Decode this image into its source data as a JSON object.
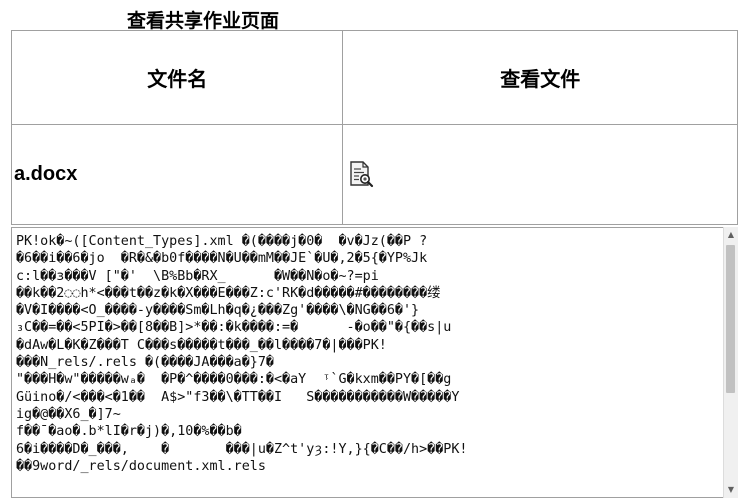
{
  "page": {
    "title": "查看共享作业页面"
  },
  "table": {
    "headers": [
      "文件名",
      "查看文件"
    ],
    "rows": [
      {
        "file_name": "a.docx",
        "view_icon": "document-search-icon"
      }
    ]
  },
  "preview": {
    "content": "PK!ok�~([Content_Types].xml �(����j�0�  �v�Jz(��P ?\n�6��i��6�jo  �R�&�b0f����N�U��mM��JE`�U�,2�5{�YP%Jk\nc:l��з���V [\"�'  \\B%Bb�RX_      �W��N�o�~?=pi\n��k��2◌◌h*<���t��z�k�X���E���Z:c'RK�d�����#��������缕\n�V�I����<O_����-y����Sm�Lh�q�¿���Zg'����\\�NG��6�'}\n₃C��=��<5PI�>��[8��B]>*��:�k����:=�      -�o��\"�{��s|u\n�dAw�L�K�Z���T C���s�����t���_��l����7�|���PK!\n���N_rels/.rels �(����JA���a�}7�\n\"���H�w\"�����wₐ�  �P�^����0���:�<�aY  ᵎ`G�kxm��PY�[��g\nGüino�/<���<�1��  A$>\"f3��\\�TT��I   S�����������W�����Y\nig�@��X6_�]7~\nf��¯�ao�.b*lI�r�j)�,10�%��b�\n6�i����D�_���,    �       ���|u�Z^t'yȝ:!Y,}{�C��/h>��PK!\n��9word/_rels/document.xml.rels"
  }
}
